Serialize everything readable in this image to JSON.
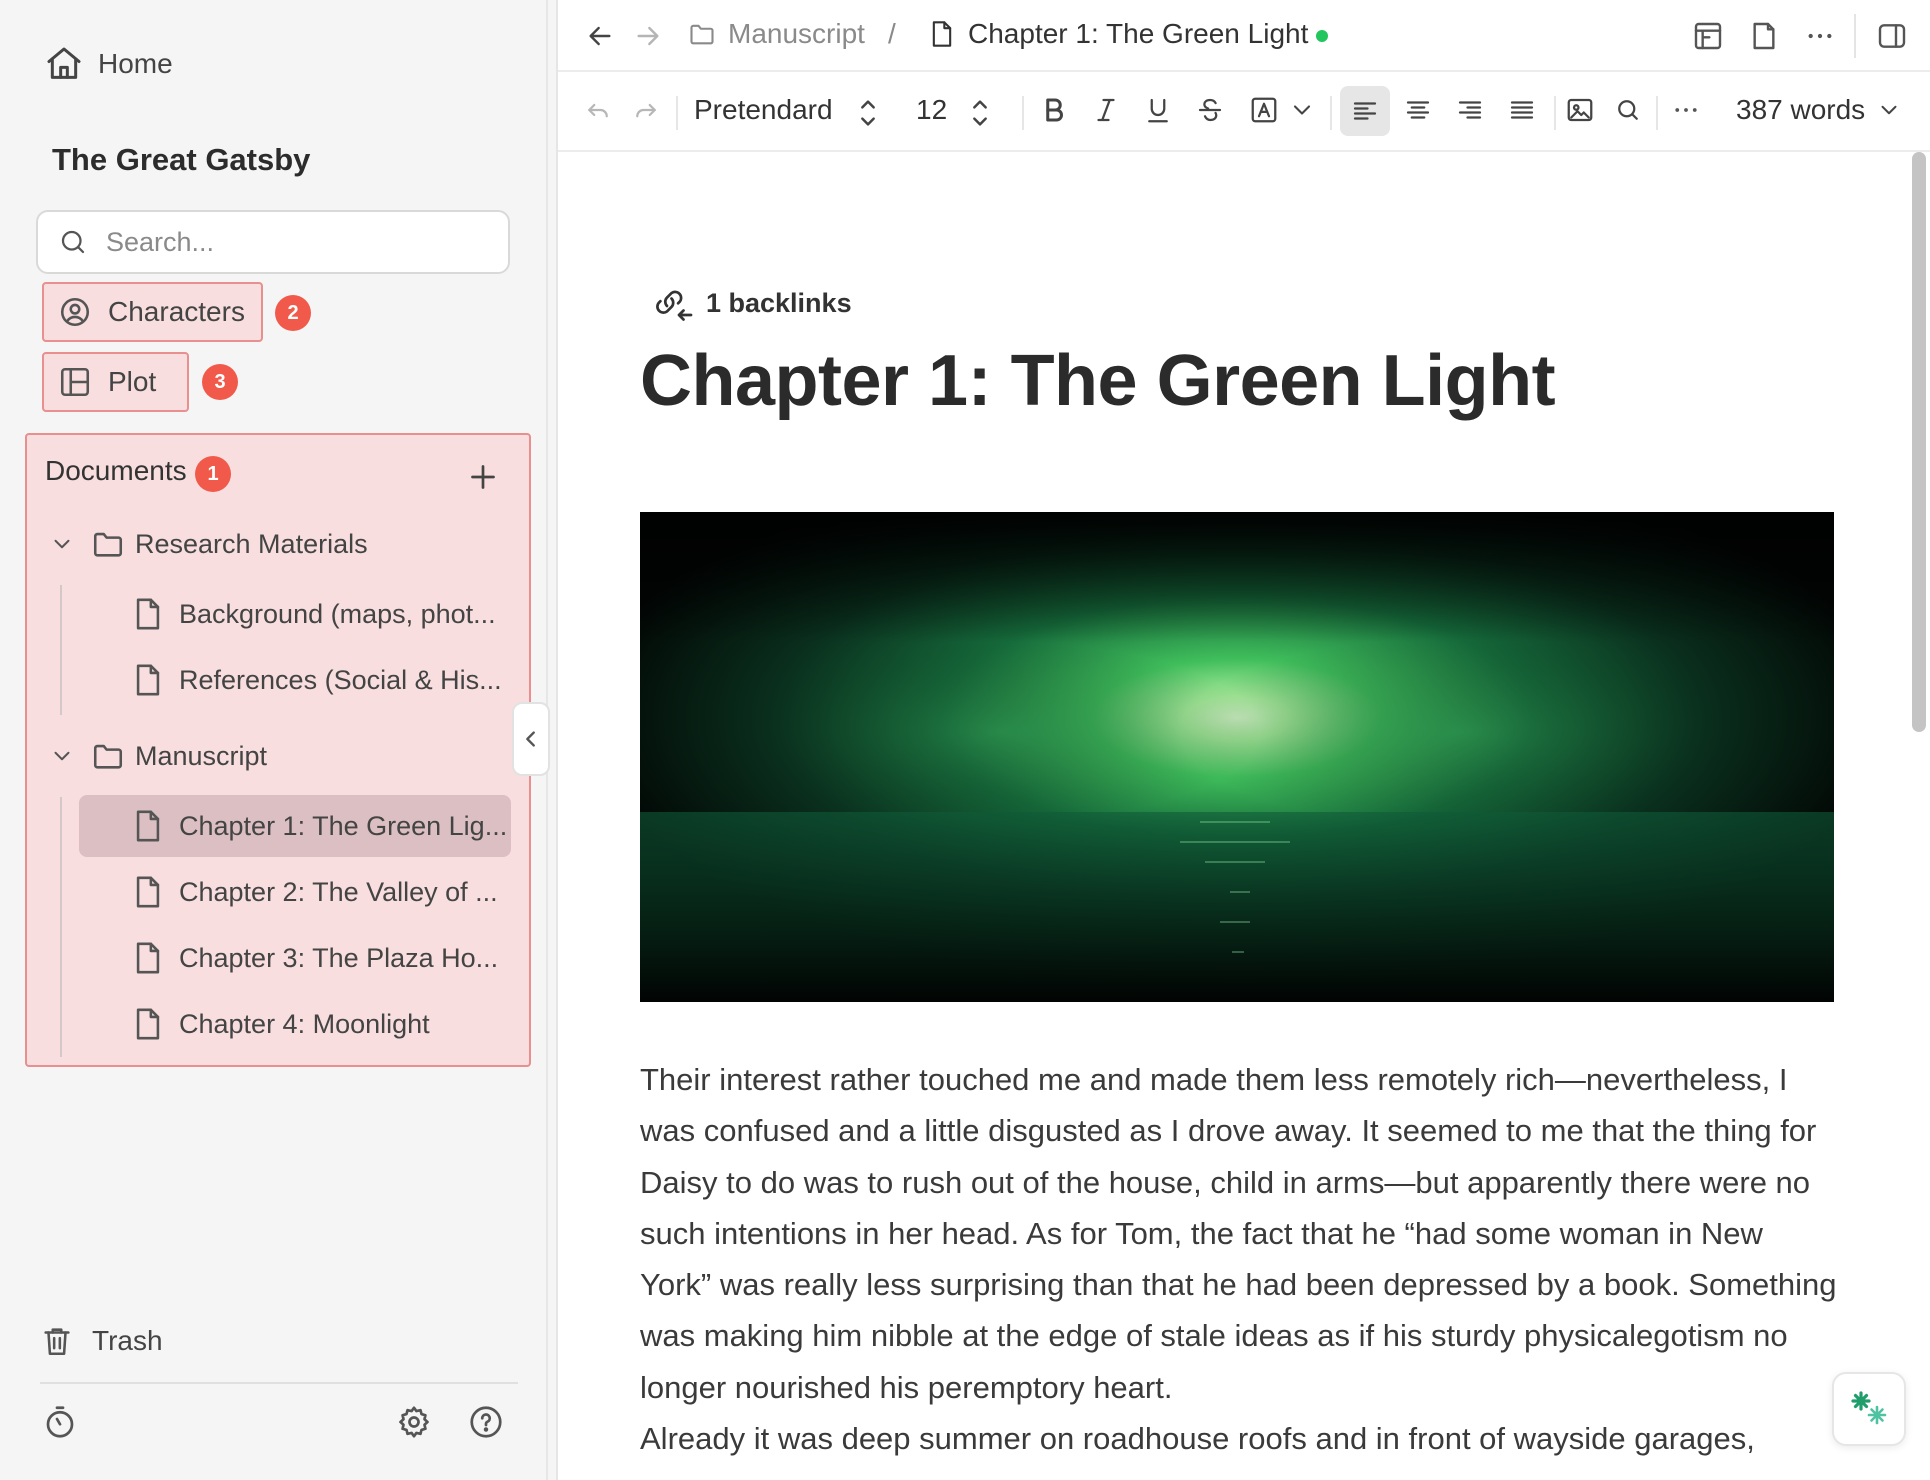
{
  "sidebar": {
    "home_label": "Home",
    "project_title": "The Great Gatsby",
    "search_placeholder": "Search...",
    "nav": [
      {
        "label": "Characters",
        "badge": "2"
      },
      {
        "label": "Plot",
        "badge": "3"
      }
    ],
    "documents": {
      "header": "Documents",
      "badge": "1",
      "folders": [
        {
          "name": "Research Materials",
          "items": [
            "Background (maps, phot...",
            "References (Social & His..."
          ]
        },
        {
          "name": "Manuscript",
          "items": [
            "Chapter 1: The Green Lig...",
            "Chapter 2: The Valley of ...",
            "Chapter 3: The Plaza Ho...",
            "Chapter 4: Moonlight"
          ]
        }
      ],
      "active_item": "Chapter 1: The Green Lig..."
    },
    "trash_label": "Trash"
  },
  "topbar": {
    "breadcrumb_folder": "Manuscript",
    "breadcrumb_separator": "/",
    "breadcrumb_doc": "Chapter 1: The Green Light",
    "saved_status_color": "#22c55e"
  },
  "toolbar": {
    "font_family": "Pretendard",
    "font_size": "12",
    "word_count": "387 words",
    "active_alignment": "align-left"
  },
  "document": {
    "backlinks": "1 backlinks",
    "title": "Chapter 1: The Green Light",
    "image_icon": "green-light-over-water-image",
    "paragraphs": [
      "Their interest rather touched me and made them less remotely rich—nevertheless, I was confused and a little disgusted as I drove away. It seemed to me that the thing for Daisy to do was to rush out of the house, child in arms—but apparently there were no such intentions in her head. As for Tom, the fact that he “had some woman in New York” was really less surprising than that he had been depressed by a book. Something was making him nibble at the edge of stale ideas as if his sturdy physicalegotism no longer nourished his peremptory heart.",
      "Already it was deep summer on roadhouse roofs and in front of wayside garages,"
    ]
  },
  "colors": {
    "highlight_fill": "#f8dede",
    "highlight_border": "#e98f8f",
    "badge": "#f15a4a",
    "active_doc": "#dcbfc2"
  }
}
